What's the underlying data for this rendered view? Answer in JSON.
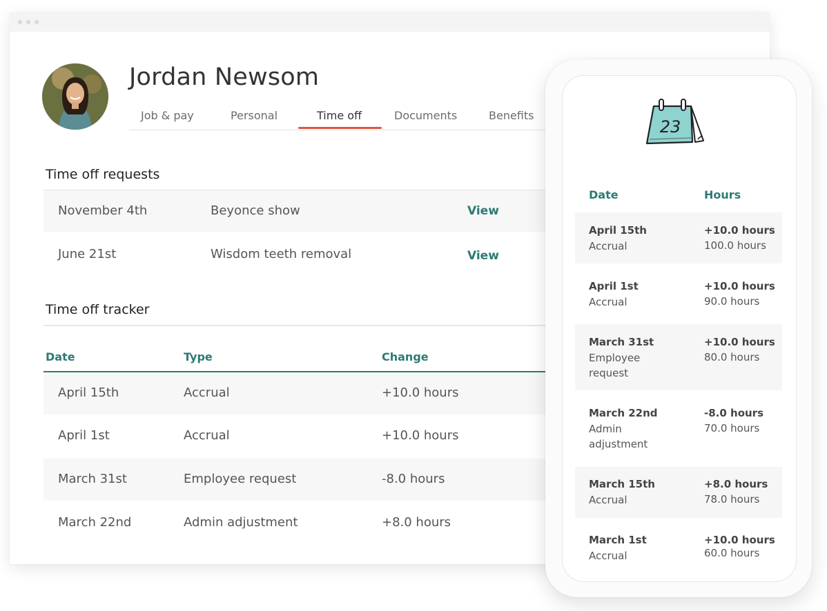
{
  "employee": {
    "name": "Jordan Newsom"
  },
  "tabs": [
    {
      "label": "Job & pay"
    },
    {
      "label": "Personal"
    },
    {
      "label": "Time off"
    },
    {
      "label": "Documents"
    },
    {
      "label": "Benefits"
    }
  ],
  "active_tab": "Time off",
  "requests": {
    "title": "Time off requests",
    "rows": [
      {
        "date": "November 4th",
        "reason": "Beyonce show",
        "action": "View"
      },
      {
        "date": "June 21st",
        "reason": "Wisdom teeth removal",
        "action": "View"
      }
    ]
  },
  "tracker": {
    "title": "Time off tracker",
    "headers": {
      "date": "Date",
      "type": "Type",
      "change": "Change"
    },
    "rows": [
      {
        "date": "April 15th",
        "type": "Accrual",
        "change": "+10.0 hours"
      },
      {
        "date": "April 1st",
        "type": "Accrual",
        "change": "+10.0 hours"
      },
      {
        "date": "March 31st",
        "type": "Employee request",
        "change": "-8.0 hours"
      },
      {
        "date": "March 22nd",
        "type": "Admin adjustment",
        "change": "+8.0 hours"
      }
    ]
  },
  "mobile": {
    "calendar_day": "23",
    "headers": {
      "date": "Date",
      "hours": "Hours"
    },
    "rows": [
      {
        "date": "April 15th",
        "type": "Accrual",
        "change": "+10.0 hours",
        "total": "100.0 hours"
      },
      {
        "date": "April 1st",
        "type": "Accrual",
        "change": "+10.0 hours",
        "total": "90.0 hours"
      },
      {
        "date": "March 31st",
        "type": "Employee request",
        "change": "+10.0 hours",
        "total": "80.0 hours"
      },
      {
        "date": "March 22nd",
        "type": "Admin adjustment",
        "change": "-8.0 hours",
        "total": "70.0 hours"
      },
      {
        "date": "March 15th",
        "type": "Accrual",
        "change": "+8.0 hours",
        "total": "78.0 hours"
      },
      {
        "date": "March 1st",
        "type": "Accrual",
        "change": "+10.0 hours",
        "total": "60.0 hours"
      }
    ]
  },
  "colors": {
    "accent_teal": "#2c7a73",
    "tab_underline": "#e2553d",
    "calendar_fill": "#8fd3d0"
  },
  "icons": {
    "calendar": "calendar-icon"
  }
}
